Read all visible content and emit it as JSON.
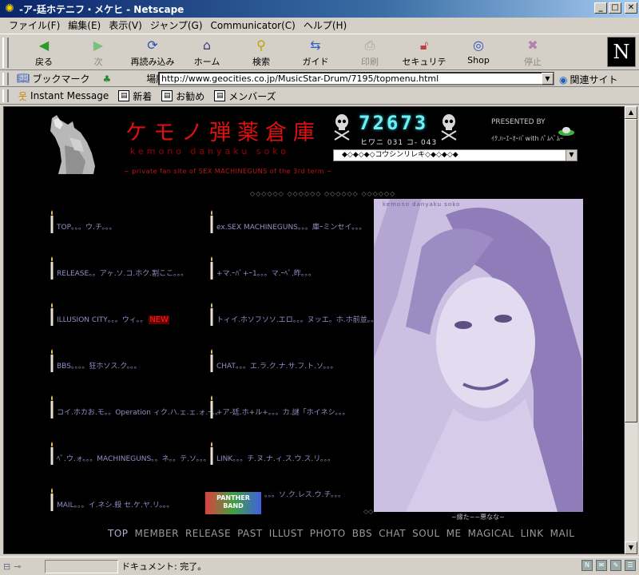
{
  "window": {
    "title": "-ア-廷ホテニフ・メケヒ - Netscape"
  },
  "menubar": [
    "ファイル(F)",
    "編集(E)",
    "表示(V)",
    "ジャンプ(G)",
    "Communicator(C)",
    "ヘルプ(H)"
  ],
  "toolbar": {
    "back": "戻る",
    "forward": "次",
    "reload": "再読み込み",
    "home": "ホーム",
    "search": "検索",
    "guide": "ガイド",
    "print": "印刷",
    "security": "セキュリティ",
    "shop": "Shop",
    "stop": "停止",
    "logo": "N"
  },
  "location": {
    "bookmarks_label": "ブックマーク",
    "location_label": "場所:",
    "url": "http://www.geocities.co.jp/MusicStar-Drum/7195/topmenu.html",
    "related_label": "関連サイト"
  },
  "personal": {
    "instant_message": "Instant Message",
    "new": "新着",
    "recommend": "お勧め",
    "members": "メンバーズ"
  },
  "page": {
    "title": "ケモノ弾薬倉庫",
    "romaji": "kemono danyaku soko",
    "subtitle": "~ private fan site of SEX MACHINEGUNS of the 3rd term ~",
    "counter": "72673",
    "counter_sub": "ヒワニ 031 コ- 043",
    "presented_by": "PRESENTED BY",
    "presented_names": "ｲｸ.ﾊｰｴｰｵｰﾊﾟwith ﾊﾟﾑﾍﾞﾑｰ",
    "select_value": "◆◇◆◇◆◇コウシンリレキ◇◆◇◆◇◆",
    "dots_top": "◇◇◇◇◇◇ ◇◇◇◇◇◇ ◇◇◇◇◇◇ ◇◇◇◇◇◇",
    "menu_left": [
      "TOP。。。ウ.チ。。。",
      "RELEASE。。アヶ.ソ.コ.ホク.割ここ。。。",
      "ILLUSION CITY。。。ウィ。。",
      "BBS。。。。狂ホソス.ク。。。",
      "コイ.ホカお.モ。。Operation ィク.ハ.ェ.ェ.ォ.ｰ。。",
      "ﾍﾟ.ウ.ォ。。。MACHINEGUNS。。ネ。。テ.ソ。。。",
      "MAIL。。。イ.ネシ.殺 セ.ケ.ヤ.リ。。。"
    ],
    "new_badge": "NEW",
    "menu_right": [
      "ex.SEX MACHINEGUNS。。。庫ｰミンセイ。。。",
      "+マ.ｰﾊﾟ+ｰ1。。。マ.ｰﾍﾟ.昨。。。",
      "トィイ.ホソフソソ.エロ。。。ヌッエ。ホ.ホ前並。。。",
      "CHAT。。。エ.ラ.ク.ナ.サ.フ.ト.ソ。。。",
      "+ア-廷.ホ+ル+。。。カ.謎「ホイネシ。。。",
      "LINK。。。チ.ヌ.ナ.ィ.ス.ウ.ス.リ。。。",
      "。。。ソ.ク.レス.ウ.チ。。。"
    ],
    "banner": "PANTHER BAND",
    "photo_text": "kemono danyaku soko",
    "photo_caption": "~縁た~~悪なな~",
    "bottom_dots": "◇◇",
    "nav": [
      "TOP",
      "MEMBER",
      "RELEASE",
      "PAST",
      "ILLUST",
      "PHOTO",
      "BBS",
      "CHAT",
      "SOUL",
      "ME",
      "MAGICAL",
      "LINK",
      "MAIL"
    ]
  },
  "status": {
    "text": "ドキュメント: 完了。"
  }
}
